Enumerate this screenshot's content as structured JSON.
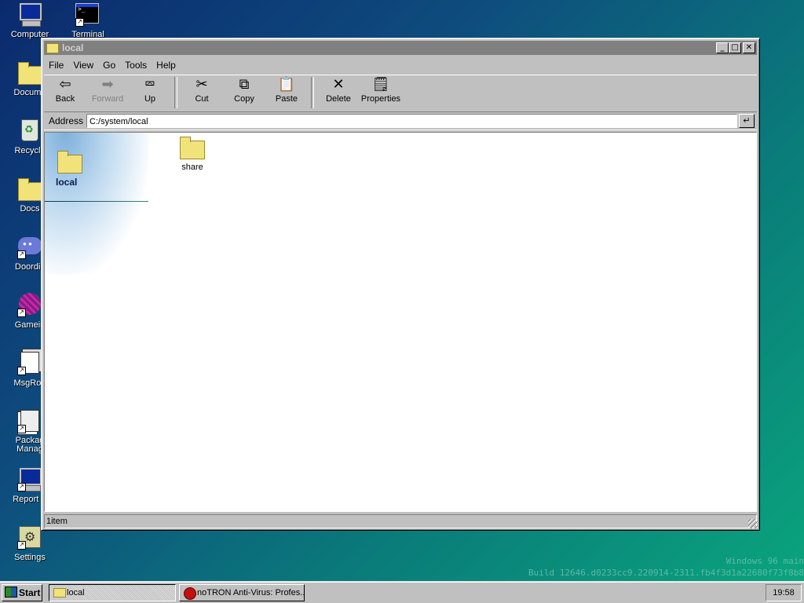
{
  "desktop": {
    "icons": [
      {
        "label": "Computer",
        "icon": "computer-icon"
      },
      {
        "label": "Terminal",
        "icon": "terminal-icon"
      },
      {
        "label": "Docume",
        "icon": "folder-icon"
      },
      {
        "label": "Recycle",
        "icon": "recycle-bin-icon"
      },
      {
        "label": "Docs",
        "icon": "folder-icon"
      },
      {
        "label": "Doordis",
        "icon": "chat-app-icon"
      },
      {
        "label": "Gamein",
        "icon": "game-icon"
      },
      {
        "label": "MsgRoo",
        "icon": "message-room-icon"
      },
      {
        "label": "Packag\nManag",
        "icon": "package-manager-icon"
      },
      {
        "label": "Report B",
        "icon": "report-icon"
      },
      {
        "label": "Settings",
        "icon": "settings-icon"
      }
    ],
    "watermark": {
      "line1": "Windows 96 main",
      "line2": "Build 12646.d0233cc9.220914-2311.fb4f3d1a22680f73f8b8"
    }
  },
  "window": {
    "title": "local",
    "menu": [
      "File",
      "View",
      "Go",
      "Tools",
      "Help"
    ],
    "toolbar": {
      "back": "Back",
      "forward": "Forward",
      "up": "Up",
      "cut": "Cut",
      "copy": "Copy",
      "paste": "Paste",
      "delete": "Delete",
      "properties": "Properties"
    },
    "address": {
      "label": "Address",
      "value": "C:/system/local",
      "go_glyph": "↵"
    },
    "banner_title": "local",
    "items": [
      {
        "name": "share",
        "type": "folder"
      }
    ],
    "status": "1item"
  },
  "taskbar": {
    "start": "Start",
    "tasks": [
      {
        "label": "local",
        "icon": "folder-icon",
        "active": true
      },
      {
        "label": "noTRON Anti-Virus: Profes...",
        "icon": "antivirus-icon",
        "active": false
      }
    ],
    "clock": "19:58"
  }
}
